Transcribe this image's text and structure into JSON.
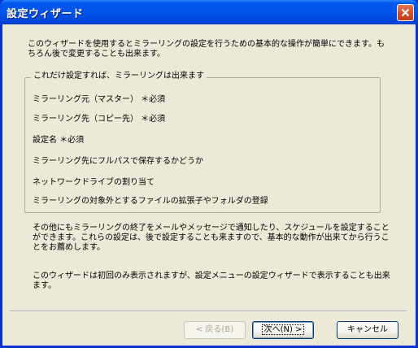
{
  "window": {
    "title": "設定ウィザード"
  },
  "intro": {
    "text": "このウィザードを使用するとミラーリングの設定を行うための基本的な操作が簡単にできます。もちろん後で変更することも出来ます。"
  },
  "group": {
    "legend": "これだけ設定すれば、ミラーリングは出来ます",
    "items": [
      "ミラーリング元（マスター） ＊必須",
      "ミラーリング先（コピー先） ＊必須",
      "設定名 ＊必須",
      "ミラーリング先にフルパスで保存するかどうか",
      "ネットワークドライブの割り当て",
      "ミラーリングの対象外とするファイルの拡張子やフォルダの登録"
    ]
  },
  "notes": {
    "para2": "その他にもミラーリングの終了をメールやメッセージで通知したり、スケジュールを設定することができます。これらの設定は、後で設定することも来ますので、基本的な動作が出来てから行うことをお薦めします。",
    "para3": "このウィザードは初回のみ表示されますが、設定メニューの設定ウィザードで表示することも出来ます。"
  },
  "buttons": {
    "back": "< 戻る(B)",
    "next": "次へ(N) >",
    "cancel": "キャンセル"
  },
  "colors": {
    "titlebar": "#0055ea",
    "dialog_bg": "#ece9d8",
    "close_button": "#d6502b"
  }
}
